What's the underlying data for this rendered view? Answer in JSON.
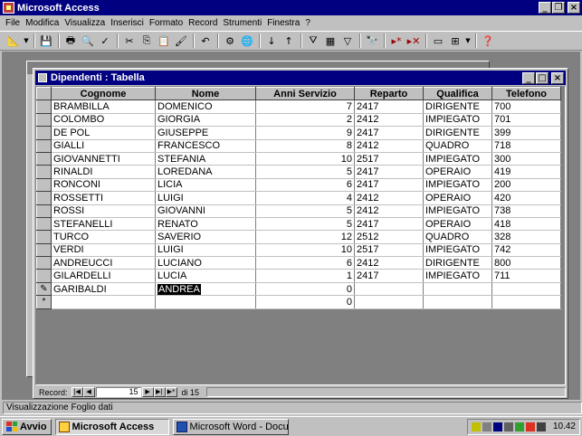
{
  "app": {
    "title": "Microsoft Access"
  },
  "menu": [
    "File",
    "Modifica",
    "Visualizza",
    "Inserisci",
    "Formato",
    "Record",
    "Strumenti",
    "Finestra",
    "?"
  ],
  "table_window": {
    "title": "Dipendenti : Tabella"
  },
  "columns": [
    "Cognome",
    "Nome",
    "Anni Servizio",
    "Reparto",
    "Qualifica",
    "Telefono"
  ],
  "rows": [
    [
      "BRAMBILLA",
      "DOMENICO",
      "7",
      "2417",
      "DIRIGENTE",
      "700"
    ],
    [
      "COLOMBO",
      "GIORGIA",
      "2",
      "2412",
      "IMPIEGATO",
      "701"
    ],
    [
      "DE POL",
      "GIUSEPPE",
      "9",
      "2417",
      "DIRIGENTE",
      "399"
    ],
    [
      "GIALLI",
      "FRANCESCO",
      "8",
      "2412",
      "QUADRO",
      "718"
    ],
    [
      "GIOVANNETTI",
      "STEFANIA",
      "10",
      "2517",
      "IMPIEGATO",
      "300"
    ],
    [
      "RINALDI",
      "LOREDANA",
      "5",
      "2417",
      "OPERAIO",
      "419"
    ],
    [
      "RONCONI",
      "LICIA",
      "6",
      "2417",
      "IMPIEGATO",
      "200"
    ],
    [
      "ROSSETTI",
      "LUIGI",
      "4",
      "2412",
      "OPERAIO",
      "420"
    ],
    [
      "ROSSI",
      "GIOVANNI",
      "5",
      "2412",
      "IMPIEGATO",
      "738"
    ],
    [
      "STEFANELLI",
      "RENATO",
      "5",
      "2417",
      "OPERAIO",
      "418"
    ],
    [
      "TURCO",
      "SAVERIO",
      "12",
      "2512",
      "QUADRO",
      "328"
    ],
    [
      "VERDI",
      "LUIGI",
      "10",
      "2517",
      "IMPIEGATO",
      "742"
    ],
    [
      "ANDREUCCI",
      "LUCIANO",
      "6",
      "2412",
      "DIRIGENTE",
      "800"
    ],
    [
      "GILARDELLI",
      "LUCIA",
      "1",
      "2417",
      "IMPIEGATO",
      "711"
    ]
  ],
  "editing_row": {
    "marker": "✎",
    "cognome": "GARIBALDI",
    "nome": "ANDREA",
    "anni": "0"
  },
  "new_row": {
    "marker": "*",
    "anni": "0"
  },
  "navigation": {
    "label": "Record:",
    "current": "15",
    "of_label": "di 15"
  },
  "status": {
    "text": "Visualizzazione Foglio dati"
  },
  "taskbar": {
    "start": "Avvio",
    "tasks": [
      "Microsoft Access",
      "Microsoft Word - Documen..."
    ],
    "clock": "10.42"
  }
}
